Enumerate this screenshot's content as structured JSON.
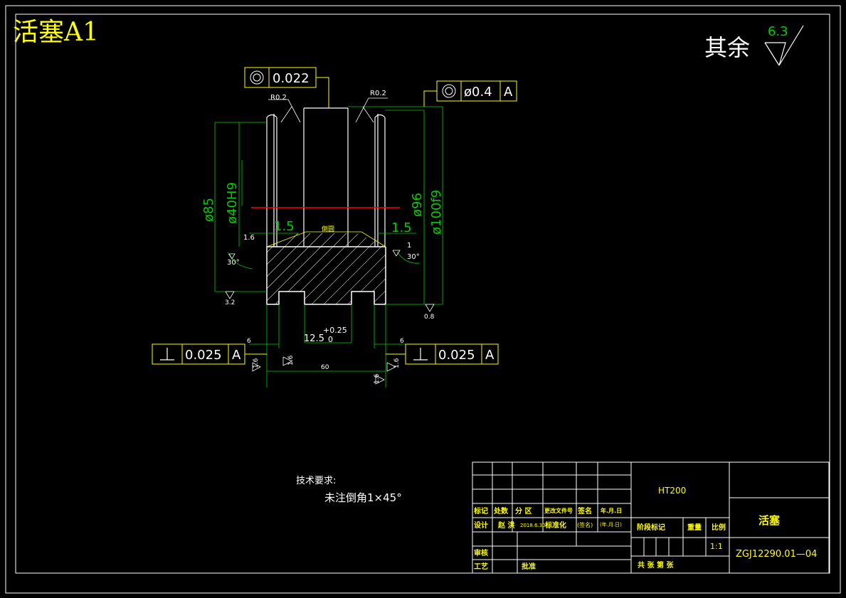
{
  "header": {
    "title": "活塞A1"
  },
  "roughness_note": {
    "label": "其余",
    "value": "6.3"
  },
  "feature_frames": {
    "concentricity_top": {
      "value": "0.022"
    },
    "concentricity_right": {
      "value": "ø0.4",
      "datum": "A"
    },
    "perp_left": {
      "value": "0.025",
      "datum": "A"
    },
    "perp_right": {
      "value": "0.025",
      "datum": "A"
    }
  },
  "dimensions": {
    "r_left": "R0.2",
    "r_right": "R0.2",
    "d85": "ø85",
    "d40": "ø40H9",
    "d96": "ø96",
    "d100": "ø100f9",
    "w_left": "1.5",
    "w_right": "1.5",
    "chamfer_label": "倒圆",
    "rough_16_left": "1.6",
    "rough_1_right": "1",
    "angle_left": "30°",
    "angle_right": "30°",
    "rough_32": "3.2",
    "rough_08": "0.8",
    "slot_width": "12.5",
    "slot_tol_upper": "+0.25",
    "slot_tol_lower": "0",
    "gap_left": "6",
    "gap_right": "6",
    "total_width": "60",
    "rough_16_a": "1.6",
    "rough_16_b": "1.6",
    "rough_16_c": "1.6",
    "rough_16_d": "1.6"
  },
  "notes": {
    "heading": "技术要求:",
    "line1": "未注倒角1×45°"
  },
  "title_block": {
    "material": "HT200",
    "part_name": "活塞",
    "drawing_number": "ZGJ12290.01—04",
    "scale": "1:1",
    "h_mark": "标记",
    "h_count": "处数",
    "h_zone": "分 区",
    "h_change_doc": "更改文件号",
    "h_sign": "签名",
    "h_date": "年.月.日",
    "design": "设计",
    "designer": "赵 洪",
    "design_date": "2018.6.30",
    "standardize": "标准化",
    "sign2": "(签名)",
    "date2": "(年.月.日)",
    "stage_mark": "阶段标记",
    "weight": "重量",
    "ratio": "比例",
    "review": "审核",
    "process": "工艺",
    "approve": "批准",
    "sheets": "共  张  第  张"
  }
}
